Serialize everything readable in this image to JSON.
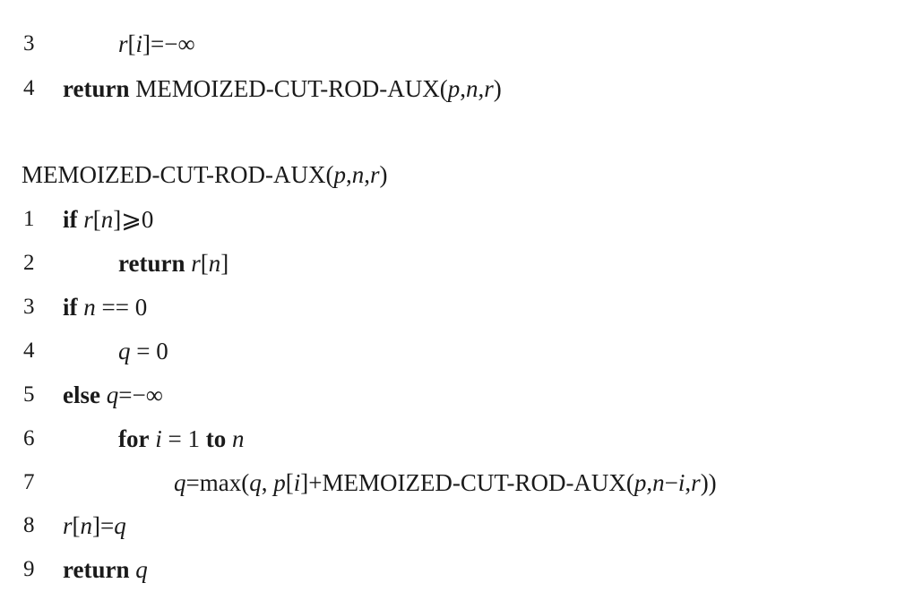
{
  "top_block": {
    "lines": [
      {
        "num": "3",
        "parts": [
          {
            "t": "r",
            "s": "it"
          },
          {
            "t": "[",
            "s": ""
          },
          {
            "t": "i",
            "s": "it"
          },
          {
            "t": "]=−∞",
            "s": ""
          }
        ]
      },
      {
        "num": "4",
        "parts": [
          {
            "t": "return",
            "s": "kw"
          },
          {
            "t": " MEMOIZED-CUT-ROD-AUX(",
            "s": ""
          },
          {
            "t": "p",
            "s": "it"
          },
          {
            "t": ",",
            "s": ""
          },
          {
            "t": "n",
            "s": "it"
          },
          {
            "t": ",",
            "s": ""
          },
          {
            "t": "r",
            "s": "it"
          },
          {
            "t": ")",
            "s": ""
          }
        ]
      }
    ]
  },
  "procedure_header": {
    "parts": [
      {
        "t": "MEMOIZED-CUT-ROD-AUX(",
        "s": ""
      },
      {
        "t": "p",
        "s": "it"
      },
      {
        "t": ",",
        "s": ""
      },
      {
        "t": "n",
        "s": "it"
      },
      {
        "t": ",",
        "s": ""
      },
      {
        "t": "r",
        "s": "it"
      },
      {
        "t": ")",
        "s": ""
      }
    ]
  },
  "body_block": {
    "lines": [
      {
        "num": "1",
        "parts": [
          {
            "t": "if",
            "s": "kw"
          },
          {
            "t": " ",
            "s": ""
          },
          {
            "t": "r",
            "s": "it"
          },
          {
            "t": "[",
            "s": ""
          },
          {
            "t": "n",
            "s": "it"
          },
          {
            "t": "]⩾0",
            "s": ""
          }
        ]
      },
      {
        "num": "2",
        "parts": [
          {
            "t": "return",
            "s": "kw"
          },
          {
            "t": " ",
            "s": ""
          },
          {
            "t": "r",
            "s": "it"
          },
          {
            "t": "[",
            "s": ""
          },
          {
            "t": "n",
            "s": "it"
          },
          {
            "t": "]",
            "s": ""
          }
        ]
      },
      {
        "num": "3",
        "parts": [
          {
            "t": "if",
            "s": "kw"
          },
          {
            "t": " ",
            "s": ""
          },
          {
            "t": "n",
            "s": "it"
          },
          {
            "t": " == 0",
            "s": ""
          }
        ]
      },
      {
        "num": "4",
        "parts": [
          {
            "t": "q",
            "s": "it"
          },
          {
            "t": " = 0",
            "s": ""
          }
        ]
      },
      {
        "num": "5",
        "parts": [
          {
            "t": "else",
            "s": "kw"
          },
          {
            "t": " ",
            "s": ""
          },
          {
            "t": "q",
            "s": "it"
          },
          {
            "t": "=−∞",
            "s": ""
          }
        ]
      },
      {
        "num": "6",
        "parts": [
          {
            "t": "for",
            "s": "kw"
          },
          {
            "t": " ",
            "s": ""
          },
          {
            "t": "i",
            "s": "it"
          },
          {
            "t": " = 1 ",
            "s": ""
          },
          {
            "t": "to",
            "s": "kw"
          },
          {
            "t": " ",
            "s": ""
          },
          {
            "t": "n",
            "s": "it"
          }
        ]
      },
      {
        "num": "7",
        "parts": [
          {
            "t": "q",
            "s": "it"
          },
          {
            "t": "=max(",
            "s": ""
          },
          {
            "t": "q",
            "s": "it"
          },
          {
            "t": ", ",
            "s": ""
          },
          {
            "t": "p",
            "s": "it"
          },
          {
            "t": "[",
            "s": ""
          },
          {
            "t": "i",
            "s": "it"
          },
          {
            "t": "]+MEMOIZED-CUT-ROD-AUX(",
            "s": ""
          },
          {
            "t": "p",
            "s": "it"
          },
          {
            "t": ",",
            "s": ""
          },
          {
            "t": "n",
            "s": "it"
          },
          {
            "t": "−",
            "s": ""
          },
          {
            "t": "i",
            "s": "it"
          },
          {
            "t": ",",
            "s": ""
          },
          {
            "t": "r",
            "s": "it"
          },
          {
            "t": "))",
            "s": ""
          }
        ]
      },
      {
        "num": "8",
        "parts": [
          {
            "t": "r",
            "s": "it"
          },
          {
            "t": "[",
            "s": ""
          },
          {
            "t": "n",
            "s": "it"
          },
          {
            "t": "]=",
            "s": ""
          },
          {
            "t": "q",
            "s": "it"
          }
        ]
      },
      {
        "num": "9",
        "parts": [
          {
            "t": "return",
            "s": "kw"
          },
          {
            "t": " ",
            "s": ""
          },
          {
            "t": "q",
            "s": "it"
          }
        ]
      }
    ]
  }
}
